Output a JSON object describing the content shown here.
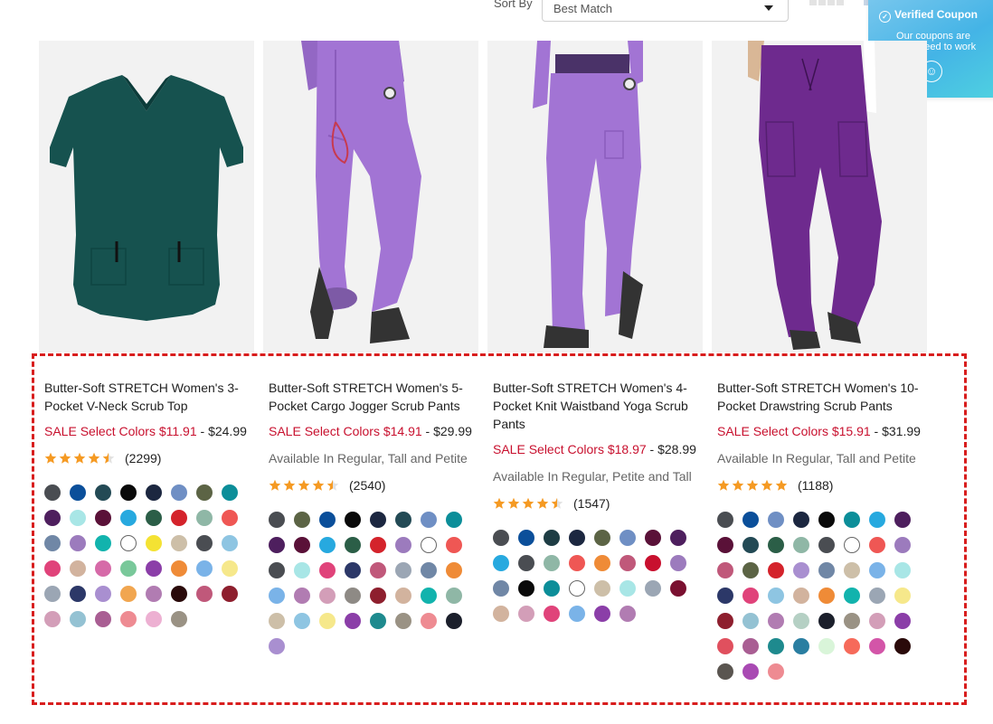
{
  "toolbar": {
    "sort_label": "Sort By",
    "sort_value": "Best Match"
  },
  "coupon": {
    "title": "Verified Coupon",
    "subtitle": "Our coupons are guaranteed to work"
  },
  "colors": {
    "sale": "#c8102e",
    "star": "#f59a23",
    "highlight": "#d81d1d",
    "coupon": "#44b4e6"
  },
  "products": [
    {
      "title": "Butter-Soft STRETCH Women's 3-Pocket V-Neck Scrub Top",
      "sale": "SALE Select Colors $11.91",
      "price_sep": " - ",
      "regular": "$24.99",
      "availability": "",
      "rating": 4.5,
      "reviews": "(2299)",
      "image": "teal v-neck scrub top",
      "swatches": [
        "#4a4d52",
        "#0b4f9a",
        "#234a55",
        "#0a0a0a",
        "#1c2740",
        "#6f8fc4",
        "#5c6445",
        "#0c8e99",
        "#4e1f5e",
        "#a8e6e6",
        "#5a1138",
        "#27a9df",
        "#2b5e47",
        "#d4232b",
        "#8fb7a6",
        "#ef5754",
        "#7087a6",
        "#9c7bbd",
        "#12b3ad",
        "#ffffff",
        "#f4e233",
        "#cdbfa8",
        "#4a4d52",
        "#8ec5e2",
        "#e0437a",
        "#d2b39e",
        "#d66aa8",
        "#79c89a",
        "#8b3ea8",
        "#ef8b37",
        "#7ab3e8",
        "#f6e88b",
        "#9ba6b4",
        "#2c3868",
        "#a98fd0",
        "#f1a650",
        "#b17cb2",
        "#2a0a0a",
        "#c0587a",
        "#8e1f2e",
        "#d39eb8",
        "#94c2d3",
        "#a95e93",
        "#ee8b92",
        "#edb0d2",
        "#9a9284"
      ]
    },
    {
      "title": "Butter-Soft STRETCH Women's 5-Pocket Cargo Jogger Scrub Pants",
      "sale": "SALE Select Colors $14.91",
      "price_sep": " - ",
      "regular": "$29.99",
      "availability": "Available In Regular, Tall and Petite",
      "rating": 4.5,
      "reviews": "(2540)",
      "image": "lavender cargo jogger scrub pants",
      "swatches": [
        "#4a4d52",
        "#5c6445",
        "#0b4f9a",
        "#0a0a0a",
        "#1c2740",
        "#234a55",
        "#6f8fc4",
        "#0c8e99",
        "#4e1f5e",
        "#5a1138",
        "#27a9df",
        "#2b5e47",
        "#d4232b",
        "#9c7bbd",
        "#ffffff",
        "#ef5754",
        "#4a4d52",
        "#a8e6e6",
        "#e0437a",
        "#2c3868",
        "#c0587a",
        "#9ba6b4",
        "#7087a6",
        "#ef8b37",
        "#7ab3e8",
        "#b17cb2",
        "#d39eb8",
        "#8e8a85",
        "#8e1f2e",
        "#d2b39e",
        "#12b3ad",
        "#8fb7a6",
        "#cdbfa8",
        "#8ec5e2",
        "#f6e88b",
        "#8b3ea8",
        "#1e8a8e",
        "#9a9284",
        "#ee8b92",
        "#1b1f2b",
        "#a98fd0"
      ]
    },
    {
      "title": "Butter-Soft STRETCH Women's 4-Pocket Knit Waistband Yoga Scrub Pants",
      "sale": "SALE Select Colors $18.97",
      "price_sep": " - ",
      "regular": "$28.99",
      "availability": "Available In Regular, Petite and Tall",
      "rating": 4.5,
      "reviews": "(1547)",
      "image": "lavender knit waistband yoga scrub pants",
      "swatches": [
        "#4a4d52",
        "#0b4f9a",
        "#1e3d44",
        "#1c2740",
        "#5c6445",
        "#6f8fc4",
        "#5a1138",
        "#4e1f5e",
        "#27a9df",
        "#4a4d52",
        "#8fb7a6",
        "#ef5754",
        "#ef8b37",
        "#c0587a",
        "#c8102e",
        "#9c7bbd",
        "#7087a6",
        "#0a0a0a",
        "#0c8e99",
        "#ffffff",
        "#cdbfa8",
        "#a8e6e6",
        "#9ba6b4",
        "#7a1030",
        "#d2b39e",
        "#d39eb8",
        "#e0437a",
        "#7ab3e8",
        "#8b3ea8",
        "#b17cb2"
      ]
    },
    {
      "title": "Butter-Soft STRETCH Women's 10-Pocket Drawstring Scrub Pants",
      "sale": "SALE Select Colors $15.91",
      "price_sep": " - ",
      "regular": "$31.99",
      "availability": "Available In Regular, Tall and Petite",
      "rating": 5,
      "reviews": "(1188)",
      "image": "purple drawstring cargo scrub pants",
      "swatches": [
        "#4a4d52",
        "#0b4f9a",
        "#6f8fc4",
        "#1c2740",
        "#0a0a0a",
        "#0c8e99",
        "#27a9df",
        "#4e1f5e",
        "#5a1138",
        "#234a55",
        "#2b5e47",
        "#8fb7a6",
        "#4a4d52",
        "#ffffff",
        "#ef5754",
        "#9c7bbd",
        "#c0587a",
        "#5c6445",
        "#d4232b",
        "#a98fd0",
        "#7087a6",
        "#cdbfa8",
        "#7ab3e8",
        "#a8e6e6",
        "#2c3868",
        "#e0437a",
        "#8ec5e2",
        "#d2b39e",
        "#ef8b37",
        "#12b3ad",
        "#9ba6b4",
        "#f6e88b",
        "#8e1f2e",
        "#94c2d3",
        "#b17cb2",
        "#b5d0c4",
        "#1b1f2b",
        "#9a9284",
        "#d39eb8",
        "#8b3ea8",
        "#e0505e",
        "#a95e93",
        "#1e8a8e",
        "#2a7ea1",
        "#d9f5d9",
        "#f66a5a",
        "#d355a8",
        "#2a0a0a",
        "#5a5550",
        "#a94ab3",
        "#ee8b92"
      ]
    }
  ]
}
